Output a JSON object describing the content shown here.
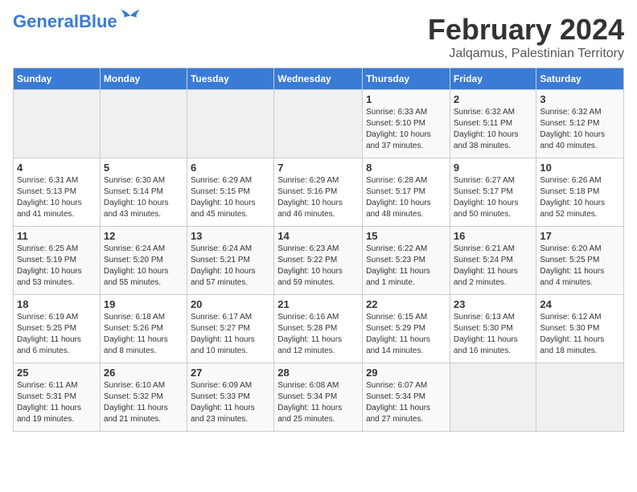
{
  "header": {
    "logo_general": "General",
    "logo_blue": "Blue",
    "title": "February 2024",
    "subtitle": "Jalqamus, Palestinian Territory"
  },
  "days_of_week": [
    "Sunday",
    "Monday",
    "Tuesday",
    "Wednesday",
    "Thursday",
    "Friday",
    "Saturday"
  ],
  "weeks": [
    [
      {
        "day": "",
        "info": ""
      },
      {
        "day": "",
        "info": ""
      },
      {
        "day": "",
        "info": ""
      },
      {
        "day": "",
        "info": ""
      },
      {
        "day": "1",
        "info": "Sunrise: 6:33 AM\nSunset: 5:10 PM\nDaylight: 10 hours\nand 37 minutes."
      },
      {
        "day": "2",
        "info": "Sunrise: 6:32 AM\nSunset: 5:11 PM\nDaylight: 10 hours\nand 38 minutes."
      },
      {
        "day": "3",
        "info": "Sunrise: 6:32 AM\nSunset: 5:12 PM\nDaylight: 10 hours\nand 40 minutes."
      }
    ],
    [
      {
        "day": "4",
        "info": "Sunrise: 6:31 AM\nSunset: 5:13 PM\nDaylight: 10 hours\nand 41 minutes."
      },
      {
        "day": "5",
        "info": "Sunrise: 6:30 AM\nSunset: 5:14 PM\nDaylight: 10 hours\nand 43 minutes."
      },
      {
        "day": "6",
        "info": "Sunrise: 6:29 AM\nSunset: 5:15 PM\nDaylight: 10 hours\nand 45 minutes."
      },
      {
        "day": "7",
        "info": "Sunrise: 6:29 AM\nSunset: 5:16 PM\nDaylight: 10 hours\nand 46 minutes."
      },
      {
        "day": "8",
        "info": "Sunrise: 6:28 AM\nSunset: 5:17 PM\nDaylight: 10 hours\nand 48 minutes."
      },
      {
        "day": "9",
        "info": "Sunrise: 6:27 AM\nSunset: 5:17 PM\nDaylight: 10 hours\nand 50 minutes."
      },
      {
        "day": "10",
        "info": "Sunrise: 6:26 AM\nSunset: 5:18 PM\nDaylight: 10 hours\nand 52 minutes."
      }
    ],
    [
      {
        "day": "11",
        "info": "Sunrise: 6:25 AM\nSunset: 5:19 PM\nDaylight: 10 hours\nand 53 minutes."
      },
      {
        "day": "12",
        "info": "Sunrise: 6:24 AM\nSunset: 5:20 PM\nDaylight: 10 hours\nand 55 minutes."
      },
      {
        "day": "13",
        "info": "Sunrise: 6:24 AM\nSunset: 5:21 PM\nDaylight: 10 hours\nand 57 minutes."
      },
      {
        "day": "14",
        "info": "Sunrise: 6:23 AM\nSunset: 5:22 PM\nDaylight: 10 hours\nand 59 minutes."
      },
      {
        "day": "15",
        "info": "Sunrise: 6:22 AM\nSunset: 5:23 PM\nDaylight: 11 hours\nand 1 minute."
      },
      {
        "day": "16",
        "info": "Sunrise: 6:21 AM\nSunset: 5:24 PM\nDaylight: 11 hours\nand 2 minutes."
      },
      {
        "day": "17",
        "info": "Sunrise: 6:20 AM\nSunset: 5:25 PM\nDaylight: 11 hours\nand 4 minutes."
      }
    ],
    [
      {
        "day": "18",
        "info": "Sunrise: 6:19 AM\nSunset: 5:25 PM\nDaylight: 11 hours\nand 6 minutes."
      },
      {
        "day": "19",
        "info": "Sunrise: 6:18 AM\nSunset: 5:26 PM\nDaylight: 11 hours\nand 8 minutes."
      },
      {
        "day": "20",
        "info": "Sunrise: 6:17 AM\nSunset: 5:27 PM\nDaylight: 11 hours\nand 10 minutes."
      },
      {
        "day": "21",
        "info": "Sunrise: 6:16 AM\nSunset: 5:28 PM\nDaylight: 11 hours\nand 12 minutes."
      },
      {
        "day": "22",
        "info": "Sunrise: 6:15 AM\nSunset: 5:29 PM\nDaylight: 11 hours\nand 14 minutes."
      },
      {
        "day": "23",
        "info": "Sunrise: 6:13 AM\nSunset: 5:30 PM\nDaylight: 11 hours\nand 16 minutes."
      },
      {
        "day": "24",
        "info": "Sunrise: 6:12 AM\nSunset: 5:30 PM\nDaylight: 11 hours\nand 18 minutes."
      }
    ],
    [
      {
        "day": "25",
        "info": "Sunrise: 6:11 AM\nSunset: 5:31 PM\nDaylight: 11 hours\nand 19 minutes."
      },
      {
        "day": "26",
        "info": "Sunrise: 6:10 AM\nSunset: 5:32 PM\nDaylight: 11 hours\nand 21 minutes."
      },
      {
        "day": "27",
        "info": "Sunrise: 6:09 AM\nSunset: 5:33 PM\nDaylight: 11 hours\nand 23 minutes."
      },
      {
        "day": "28",
        "info": "Sunrise: 6:08 AM\nSunset: 5:34 PM\nDaylight: 11 hours\nand 25 minutes."
      },
      {
        "day": "29",
        "info": "Sunrise: 6:07 AM\nSunset: 5:34 PM\nDaylight: 11 hours\nand 27 minutes."
      },
      {
        "day": "",
        "info": ""
      },
      {
        "day": "",
        "info": ""
      }
    ]
  ]
}
